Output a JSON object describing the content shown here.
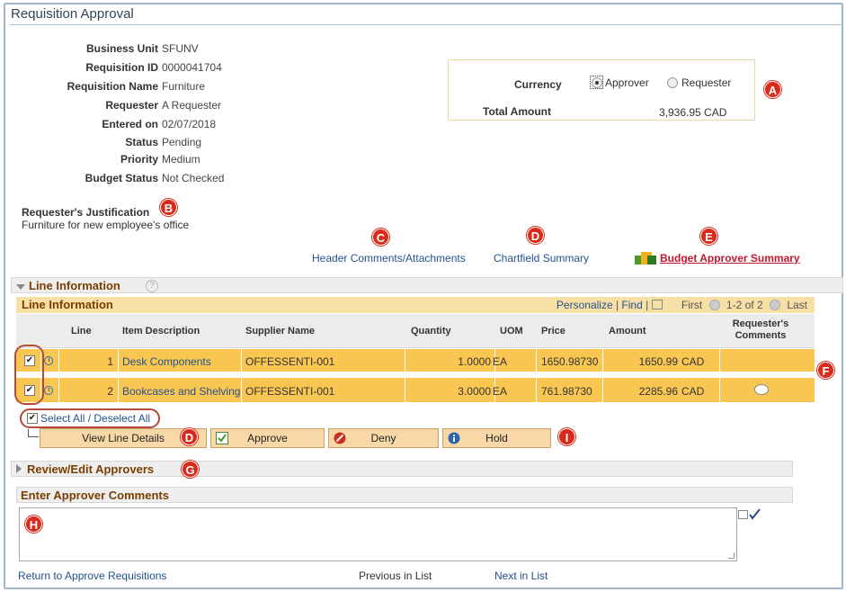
{
  "page": {
    "title": "Requisition Approval"
  },
  "header": {
    "fields": [
      {
        "label": "Business Unit",
        "value": "SFUNV"
      },
      {
        "label": "Requisition ID",
        "value": "0000041704"
      },
      {
        "label": "Requisition Name",
        "value": "Furniture"
      },
      {
        "label": "Requester",
        "value": "A Requester"
      },
      {
        "label": "Entered on",
        "value": "02/07/2018"
      },
      {
        "label": "Status",
        "value": "Pending"
      },
      {
        "label": "Priority",
        "value": "Medium"
      },
      {
        "label": "Budget Status",
        "value": "Not Checked"
      }
    ]
  },
  "currency": {
    "label": "Currency",
    "option_approver": "Approver",
    "option_requester": "Requester",
    "selected": "Approver",
    "total_label": "Total Amount",
    "total_value": "3,936.95 CAD"
  },
  "justification": {
    "label": "Requester's Justification",
    "text": "Furniture for new employee's office"
  },
  "links": {
    "header_comments": "Header Comments/Attachments",
    "chartfield_summary": "Chartfield Summary",
    "budget_approver_summary": "Budget Approver Summary"
  },
  "callouts": {
    "a": "A",
    "b": "B",
    "c": "C",
    "d": "D",
    "e": "E",
    "f": "F",
    "g": "G",
    "h": "H",
    "i": "I"
  },
  "line_section": {
    "title": "Line Information",
    "help": "?"
  },
  "grid": {
    "title": "Line Information",
    "personalize": "Personalize",
    "find": "Find",
    "first": "First",
    "range": "1-2 of 2",
    "last": "Last",
    "columns": {
      "line": "Line",
      "item": "Item Description",
      "supplier": "Supplier Name",
      "quantity": "Quantity",
      "uom": "UOM",
      "price": "Price",
      "amount": "Amount",
      "comments_1": "Requester's",
      "comments_2": "Comments"
    },
    "rows": [
      {
        "line": "1",
        "item": "Desk Components",
        "supplier": "OFFESSENTI-001",
        "quantity": "1.0000",
        "uom": "EA",
        "price": "1650.98730",
        "amount": "1650.99",
        "currency": "CAD",
        "checked": true
      },
      {
        "line": "2",
        "item": "Bookcases and Shelving",
        "supplier": "OFFESSENTI-001",
        "quantity": "3.0000",
        "uom": "EA",
        "price": "761.98730",
        "amount": "2285.96",
        "currency": "CAD",
        "checked": true
      }
    ]
  },
  "actions": {
    "select_all": "Select All / Deselect All",
    "view_line_details": "View Line Details",
    "approve": "Approve",
    "deny": "Deny",
    "hold": "Hold"
  },
  "review_section": {
    "title": "Review/Edit Approvers"
  },
  "comments_section": {
    "title": "Enter Approver Comments",
    "value": ""
  },
  "footer": {
    "return": "Return to Approve Requisitions",
    "previous": "Previous in List",
    "next": "Next in List"
  },
  "colors": {
    "grid_row": "#f8c651",
    "button": "#f9d8a8",
    "callout": "#d92b1b",
    "link": "#24528c"
  }
}
